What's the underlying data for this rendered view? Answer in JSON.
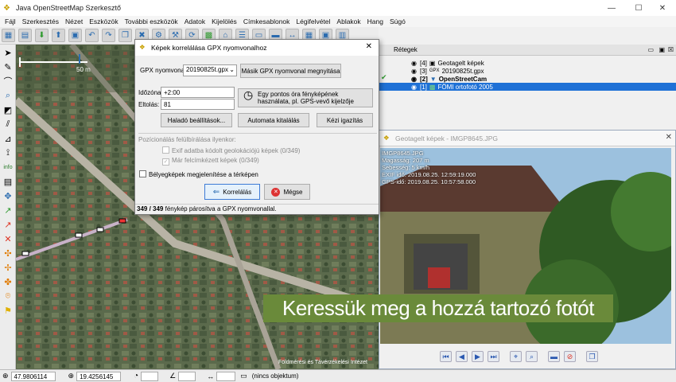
{
  "window": {
    "title": "Java OpenStreetMap Szerkesztő",
    "controls": [
      "—",
      "☐",
      "✕"
    ]
  },
  "menu": [
    "Fájl",
    "Szerkesztés",
    "Nézet",
    "Eszközök",
    "További eszközök",
    "Adatok",
    "Kijelölés",
    "Címkesablonok",
    "Légifelvétel",
    "Ablakok",
    "Hang",
    "Súgó"
  ],
  "map": {
    "scale_label": "50 m",
    "attribution": "Földmérési és Távérzékelési Intézet"
  },
  "layers_panel": {
    "title": "Rétegek",
    "layers": [
      {
        "index": "[4]",
        "name": "Geotagelt képek",
        "selected": false
      },
      {
        "index": "[3]",
        "name": "20190825t.gpx",
        "selected": false
      },
      {
        "index": "[2]",
        "name": "OpenStreetCam",
        "selected": false
      },
      {
        "index": "[1]",
        "name": "FÖMI ortofotó 2005",
        "selected": true
      }
    ]
  },
  "photo_window": {
    "title": "Geotagelt képek - IMGP8645.JPG",
    "info": [
      "IMGP8645.JPG",
      "Magasság: 207 m",
      "Sebesség: 5 km/h",
      "EXIF idő: 2019.08.25. 12:59:19.000",
      "GPS-idő: 2019.08.25. 10:57:58.000"
    ]
  },
  "dialog": {
    "title": "Képek korrelálása GPX nyomvonalhoz",
    "gpx_label": "GPX nyomvonal",
    "gpx_value": "20190825t.gpx",
    "open_other_label": "Másik GPX nyomvonal megnyitása",
    "timezone_label": "Időzóna:",
    "timezone_value": "+2:00",
    "offset_label": "Eltolás:",
    "offset_value": "81",
    "clock_button_label": "Egy pontos óra fényképének használata, pl. GPS-vevő kijelzője",
    "advanced_label": "Haladó beállítások...",
    "auto_label": "Automata kitalálás",
    "manual_label": "Kézi igazítás",
    "override_label": "Pozícionálás felülbírálása ilyenkor:",
    "exif_label": "Exif adatba kódolt geolokációjú képek (0/349)",
    "tagged_label": "Már felcímkézett képek (0/349)",
    "show_thumbs_label": "Bélyegképek megjelenítése a térképen",
    "ok_label": "Korrelálás",
    "cancel_label": "Mégse",
    "status_count": "349 / 349",
    "status_text": " fénykép párosítva a GPX nyomvonallal."
  },
  "statusbar": {
    "lat": "47.9806114",
    "lon": "19.4256145",
    "object": "(nincs objektum)"
  },
  "caption": "Keressük meg a hozzá tartozó fotót"
}
